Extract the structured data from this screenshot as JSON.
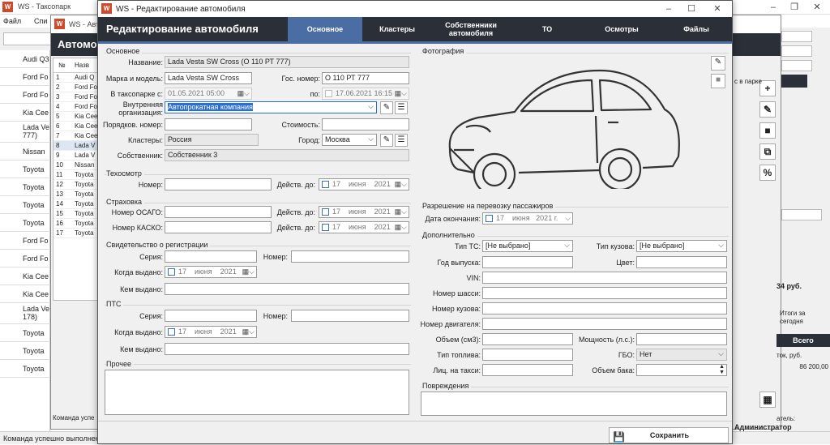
{
  "main": {
    "title": "WS - Таксопарк",
    "menu": [
      "Файл",
      "Спи"
    ],
    "status": "Команда успешно выполнена",
    "left_rows": [
      "Audi Q3",
      "Ford Fo",
      "Ford Fo",
      "Kia Cee",
      "Lada Ve 777)",
      "Nissan",
      "Toyota",
      "Toyota",
      "Toyota",
      "Toyota",
      "Ford Fo",
      "Ford Fo",
      "Kia Cee",
      "Kia Cee",
      "Lada Ve 178)",
      "Toyota",
      "Toyota",
      "Toyota"
    ]
  },
  "second": {
    "title": "WS - Авто",
    "header": "Автомо",
    "col_no": "№",
    "col_name": "Назв",
    "rows": [
      [
        "1",
        "Audi Q"
      ],
      [
        "2",
        "Ford Fo"
      ],
      [
        "3",
        "Ford Fo"
      ],
      [
        "4",
        "Ford Fo"
      ],
      [
        "5",
        "Kia Cee"
      ],
      [
        "6",
        "Kia Cee"
      ],
      [
        "7",
        "Kia Cee"
      ],
      [
        "8",
        "Lada V"
      ],
      [
        "9",
        "Lada V"
      ],
      [
        "10",
        "Nissan"
      ],
      [
        "11",
        "Toyota"
      ],
      [
        "12",
        "Toyota"
      ],
      [
        "13",
        "Toyota"
      ],
      [
        "14",
        "Toyota"
      ],
      [
        "15",
        "Toyota"
      ],
      [
        "16",
        "Toyota"
      ],
      [
        "17",
        "Toyota"
      ]
    ],
    "status": "Команда успе",
    "right": {
      "park": "с в парке",
      "sum": "34 руб.",
      "totals_label": "Итоги за сегодня",
      "col_total": "Всего",
      "col_cost": "ток, руб.",
      "total_value": "86 200,00",
      "tel": "атель:",
      "admin": "Администратор"
    }
  },
  "dialog": {
    "title": "WS - Редактирование автомобиля",
    "header": "Редактирование автомобиля",
    "tabs": [
      "Основное",
      "Кластеры",
      "Собственники автомобиля",
      "ТО",
      "Осмотры",
      "Файлы"
    ],
    "active_tab": 0,
    "basic": {
      "group": "Основное",
      "name_label": "Название:",
      "name": "Lada Vesta SW Cross (О 110 РТ 777)",
      "model_label": "Марка и модель:",
      "model": "Lada Vesta SW Cross",
      "plate_label": "Гос. номер:",
      "plate": "О 110 РТ 777",
      "since_label": "В таксопарке с:",
      "since": "01.05.2021 05:00",
      "until_label": "по:",
      "until": "17.06.2021 16:15",
      "org_label": "Внутренняя организация:",
      "org": "Автопрокатная компания",
      "ord_label": "Порядков. номер:",
      "ord": "",
      "cost_label": "Стоимость:",
      "cost": "",
      "cluster_label": "Кластеры:",
      "cluster": "Россия",
      "city_label": "Город:",
      "city": "Москва",
      "owner_label": "Собственник:",
      "owner": "Собственник 3"
    },
    "tech": {
      "group": "Техосмотр",
      "num_label": "Номер:",
      "valid_label": "Действ. до:",
      "day": "17",
      "month": "июня",
      "year": "2021"
    },
    "ins": {
      "group": "Страховка",
      "osago_label": "Номер ОСАГО:",
      "kasko_label": "Номер КАСКО:",
      "valid_label": "Действ. до:",
      "day": "17",
      "month": "июня",
      "year": "2021"
    },
    "reg": {
      "group": "Свидетельство о регистрации",
      "series_label": "Серия:",
      "num_label": "Номер:",
      "date_label": "Когда выдано:",
      "by_label": "Кем выдано:",
      "day": "17",
      "month": "июня",
      "year": "2021"
    },
    "pts": {
      "group": "ПТС",
      "series_label": "Серия:",
      "num_label": "Номер:",
      "date_label": "Когда выдано:",
      "by_label": "Кем выдано:",
      "day": "17",
      "month": "июня",
      "year": "2021"
    },
    "other": {
      "group": "Прочее"
    },
    "photo": {
      "group": "Фотография"
    },
    "permit": {
      "group": "Разрешение на перевозку пассажиров",
      "end_label": "Дата окончания:",
      "day": "17",
      "month": "июня",
      "year": "2021 г."
    },
    "extra": {
      "group": "Дополнительно",
      "type_label": "Тип ТС:",
      "type": "[Не выбрано]",
      "body_label": "Тип кузова:",
      "body": "[Не выбрано]",
      "year_label": "Год выпуска:",
      "color_label": "Цвет:",
      "vin_label": "VIN:",
      "chassis_label": "Номер шасси:",
      "bodynum_label": "Номер кузова:",
      "engine_label": "Номер двигателя:",
      "volume_label": "Объем (см3):",
      "power_label": "Мощность (л.с.):",
      "fuel_label": "Тип топлива:",
      "gbo_label": "ГБО:",
      "gbo": "Нет",
      "lic_label": "Лиц. на такси:",
      "tank_label": "Объем бака:"
    },
    "damage": {
      "group": "Повреждения"
    },
    "save": "Сохранить"
  },
  "colors": {
    "dark_header": "#2b2f38",
    "active_tab": "#4a6da4",
    "selection": "#2a6fd6"
  }
}
